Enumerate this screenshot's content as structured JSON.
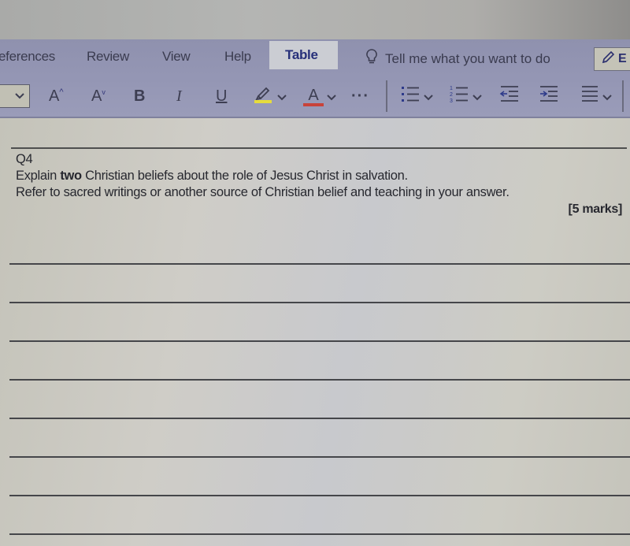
{
  "ribbon": {
    "tabs": [
      {
        "label": "eferences",
        "active": false
      },
      {
        "label": "Review",
        "active": false
      },
      {
        "label": "View",
        "active": false
      },
      {
        "label": "Help",
        "active": false
      },
      {
        "label": "Table",
        "active": true
      }
    ],
    "tell_me": {
      "icon": "lightbulb-icon",
      "placeholder": "Tell me what you want to do"
    },
    "editing_button": {
      "icon": "pencil-icon",
      "label": "E"
    }
  },
  "toolbar": {
    "font_dropdown_value": "",
    "grow_font_label": "A",
    "shrink_font_label": "A",
    "bold_label": "B",
    "italic_label": "I",
    "underline_label": "U",
    "highlight_color": "#e6dc3c",
    "font_color_label": "A",
    "font_color": "#c8433a",
    "more_label": "···",
    "buttons": [
      "bullets",
      "numbering",
      "decrease-indent",
      "increase-indent",
      "align"
    ]
  },
  "document": {
    "question_number": "Q4",
    "line1_prefix": "Explain ",
    "line1_bold": "two",
    "line1_suffix": " Christian beliefs about the role of Jesus Christ in salvation.",
    "line2": "Refer to sacred writings or another source of Christian belief and teaching in your answer.",
    "marks": "[5 marks]",
    "answer_lines": 8
  }
}
